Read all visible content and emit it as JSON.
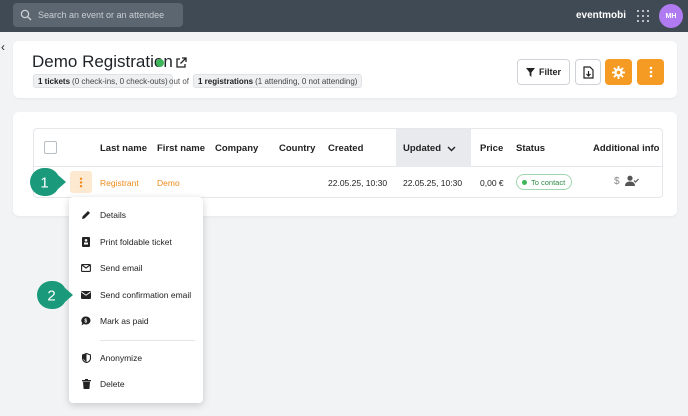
{
  "topbar": {
    "search_placeholder": "Search an event or an attendee",
    "brand": "eventmobi",
    "avatar_initials": "MH"
  },
  "header": {
    "back_glyph": "‹",
    "title": "Demo Registration",
    "status_color": "#3db558",
    "tickets_count": "1 tickets",
    "tickets_detail": "(0 check-ins, 0 check-outs)",
    "out_of": "out of",
    "registrations_count": "1 registrations",
    "registrations_detail": "(1 attending, 0 not attending)",
    "filter_label": "Filter",
    "accent": "#f59a22"
  },
  "table": {
    "columns": [
      "Last name",
      "First name",
      "Company",
      "Country",
      "Created",
      "Updated",
      "Price",
      "Status",
      "Additional info"
    ],
    "sorted_column": "Updated",
    "sort_direction": "descending",
    "row": {
      "last_name": "Registrant",
      "first_name": "Demo",
      "company": "",
      "country": "",
      "created": "22.05.25, 10:30",
      "updated": "22.05.25, 10:30",
      "price": "0,00 €",
      "status": "To contact",
      "additional_info_icons": [
        "dollar-icon",
        "user-check-icon"
      ]
    }
  },
  "menu": {
    "items": [
      {
        "label": "Details",
        "icon": "pencil-icon"
      },
      {
        "label": "Print foldable ticket",
        "icon": "ticket-icon"
      },
      {
        "label": "Send email",
        "icon": "envelope-outline-icon"
      },
      {
        "label": "Send confirmation email",
        "icon": "envelope-filled-icon"
      },
      {
        "label": "Mark as paid",
        "icon": "money-bubble-icon"
      },
      {
        "label": "Anonymize",
        "icon": "shield-icon"
      },
      {
        "label": "Delete",
        "icon": "trash-icon"
      }
    ]
  },
  "callouts": [
    "1",
    "2"
  ],
  "callout_color": "#1a9a7a"
}
